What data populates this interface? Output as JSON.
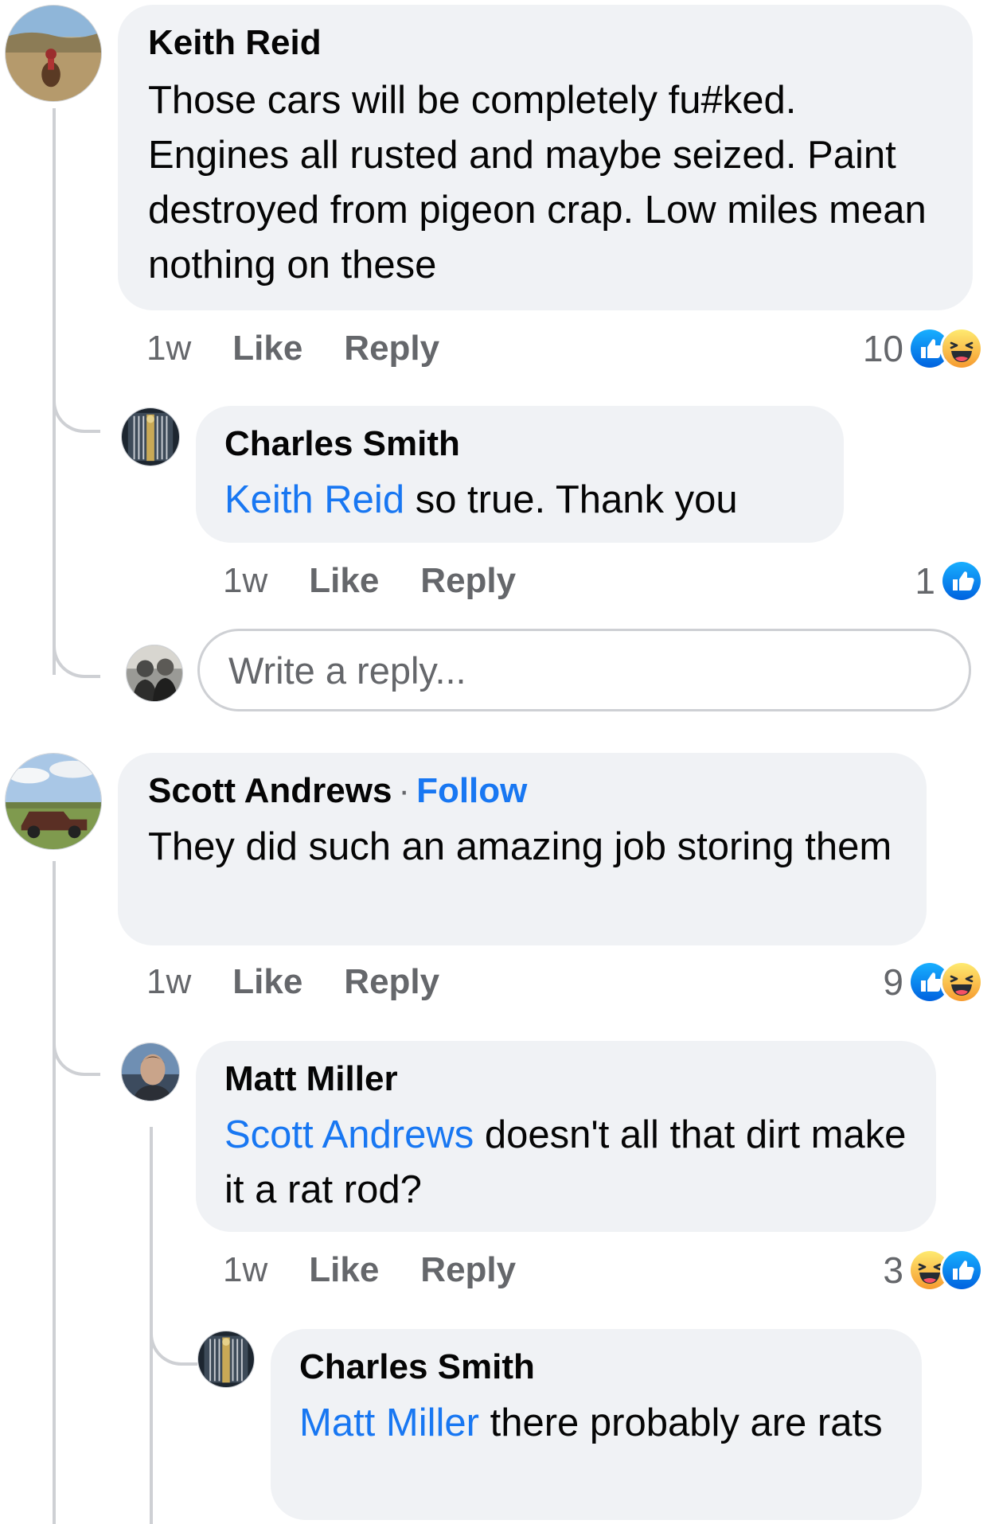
{
  "comments": [
    {
      "author": "Keith Reid",
      "text": "Those cars will be completely fu#ked. Engines all rusted and maybe seized. Paint destroyed from pigeon crap.  Low miles mean nothing on these",
      "time": "1w",
      "like_label": "Like",
      "reply_label": "Reply",
      "reaction_count": "10",
      "reactions": [
        "like-icon",
        "haha-icon"
      ],
      "replies": [
        {
          "author": "Charles Smith",
          "mention": "Keith Reid",
          "text": " so true. Thank you",
          "time": "1w",
          "like_label": "Like",
          "reply_label": "Reply",
          "reaction_count": "1",
          "reactions": [
            "like-icon"
          ]
        }
      ],
      "reply_placeholder": "Write a reply..."
    },
    {
      "author": "Scott Andrews",
      "separator": "·",
      "follow_label": "Follow",
      "text": "They did such an amazing job storing them",
      "time": "1w",
      "like_label": "Like",
      "reply_label": "Reply",
      "reaction_count": "9",
      "reactions": [
        "like-icon",
        "haha-icon"
      ],
      "replies": [
        {
          "author": "Matt Miller",
          "mention": "Scott Andrews",
          "text": " doesn't all that dirt make it a rat rod?",
          "time": "1w",
          "like_label": "Like",
          "reply_label": "Reply",
          "reaction_count": "3",
          "reactions": [
            "haha-icon",
            "like-icon"
          ],
          "replies": [
            {
              "author": "Charles Smith",
              "mention": "Matt Miller",
              "text": " there probably are rats"
            }
          ]
        }
      ]
    }
  ],
  "colors": {
    "bubble": "#f0f2f5",
    "link": "#1877f2",
    "meta": "#65676b",
    "thread_line": "#ced0d4",
    "like_blue": "#1877f2",
    "haha_yellow": "#f7b928"
  }
}
